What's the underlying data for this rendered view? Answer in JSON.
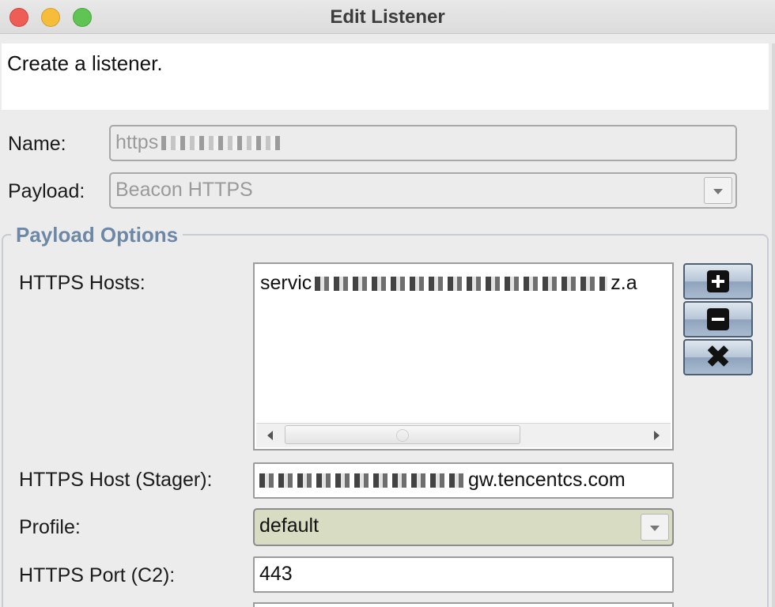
{
  "window": {
    "title": "Edit Listener"
  },
  "description": "Create a listener.",
  "form": {
    "name_label": "Name:",
    "name_value": "https",
    "payload_label": "Payload:",
    "payload_value": "Beacon HTTPS"
  },
  "payload_options": {
    "group_title": "Payload Options",
    "https_hosts_label": "HTTPS Hosts:",
    "hosts": [
      {
        "prefix": "servic",
        "suffix": "z.a"
      }
    ],
    "stager_label": "HTTPS Host (Stager):",
    "stager_suffix": "gw.tencentcs.com",
    "profile_label": "Profile:",
    "profile_value": "default",
    "port_label": "HTTPS Port (C2):",
    "port_value": "443"
  },
  "icons": {
    "add": "add-icon",
    "remove": "remove-icon",
    "clear": "clear-icon"
  },
  "colors": {
    "group_title": "#6c88a6",
    "profile_selected_bg": "#d8dcc2"
  }
}
